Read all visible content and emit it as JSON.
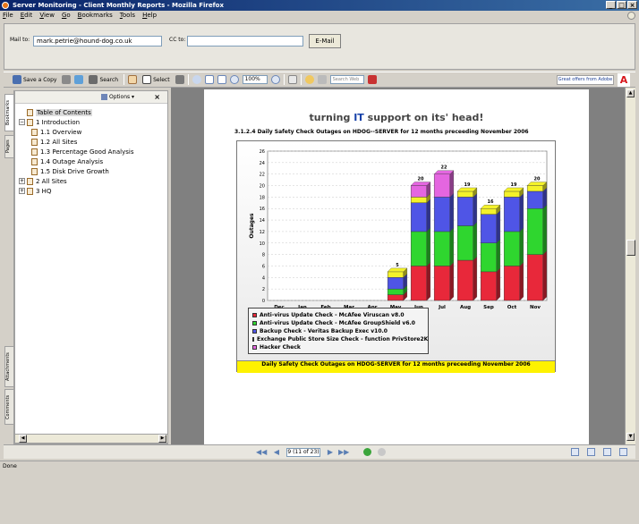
{
  "window": {
    "title": "Server Monitoring - Client Monthly Reports - Mozilla Firefox",
    "buttons": [
      "_",
      "□",
      "×"
    ]
  },
  "menu": [
    "File",
    "Edit",
    "View",
    "Go",
    "Bookmarks",
    "Tools",
    "Help"
  ],
  "mailbar": {
    "mail_to_label": "Mail to:",
    "mail_to_value": "mark.petrie@hound-dog.co.uk",
    "cc_label": "CC to:",
    "cc_value": "",
    "email_button": "E-Mail"
  },
  "toolbar": {
    "save_copy": "Save a Copy",
    "search": "Search",
    "select": "Select",
    "zoom": "100%",
    "search_web_placeholder": "Search Web",
    "adobe_offers": "Great offers from Adobe",
    "adobe_logo": "A"
  },
  "side_tabs": [
    "Bookmarks",
    "Pages",
    "Attachments",
    "Comments"
  ],
  "nav": {
    "options_label": "Options ▾",
    "close": "×",
    "tree": [
      {
        "label": "Table of Contents",
        "expander": "",
        "indent": 0
      },
      {
        "label": "1 Introduction",
        "expander": "−",
        "indent": 0
      },
      {
        "label": "1.1 Overview",
        "expander": "",
        "indent": 1
      },
      {
        "label": "1.2 All Sites",
        "expander": "",
        "indent": 1
      },
      {
        "label": "1.3 Percentage Good Analysis",
        "expander": "",
        "indent": 1
      },
      {
        "label": "1.4 Outage Analysis",
        "expander": "",
        "indent": 1
      },
      {
        "label": "1.5 Disk Drive Growth",
        "expander": "",
        "indent": 1
      },
      {
        "label": "2 All Sites",
        "expander": "+",
        "indent": 0
      },
      {
        "label": "3 HQ",
        "expander": "+",
        "indent": 0
      }
    ]
  },
  "page": {
    "title_pre": "turning ",
    "title_it": "IT",
    "title_post": " support on its' head!",
    "subtitle": "3.1.2.4 Daily Safety Check Outages on HDOG--SERVER for 12 months preceeding November 2006",
    "footer": "Daily Safety Check Outages on HDOG-SERVER for 12 months preceeding November 2006"
  },
  "chart_data": {
    "type": "bar",
    "stacked": true,
    "categories": [
      "Dec",
      "Jan",
      "Feb",
      "Mar",
      "Apr",
      "May",
      "Jun",
      "Jul",
      "Aug",
      "Sep",
      "Oct",
      "Nov"
    ],
    "ylabel": "Outages",
    "ylim": [
      0,
      26
    ],
    "yticks": [
      0,
      2,
      4,
      6,
      8,
      10,
      12,
      14,
      16,
      18,
      20,
      22,
      24,
      26
    ],
    "totals": [
      0,
      0,
      0,
      0,
      0,
      5,
      20,
      22,
      19,
      16,
      19,
      20
    ],
    "series": [
      {
        "name": "Anti-virus Update Check - McAfee Viruscan v8.0",
        "color": "#e8283a",
        "values": [
          0,
          0,
          0,
          0,
          0,
          1,
          6,
          6,
          7,
          5,
          6,
          8
        ]
      },
      {
        "name": "Anti-virus Update Check - McAfee GroupShield v6.0",
        "color": "#2fd62f",
        "values": [
          0,
          0,
          0,
          0,
          0,
          1,
          6,
          6,
          6,
          5,
          6,
          8
        ]
      },
      {
        "name": "Backup Check - Veritas Backup Exec v10.0",
        "color": "#4f55e6",
        "values": [
          0,
          0,
          0,
          0,
          0,
          2,
          5,
          6,
          5,
          5,
          6,
          3
        ]
      },
      {
        "name": "Exchange Public Store Size Check - function PrivStore2K",
        "color": "#f4f22a",
        "values": [
          0,
          0,
          0,
          0,
          0,
          1,
          1,
          0,
          1,
          1,
          1,
          1
        ]
      },
      {
        "name": "Hacker Check",
        "color": "#e466e0",
        "values": [
          0,
          0,
          0,
          0,
          0,
          0,
          2,
          4,
          0,
          0,
          0,
          0
        ]
      }
    ]
  },
  "pagenav": {
    "page_field": "9 (11 of 23)"
  },
  "status": "Done"
}
